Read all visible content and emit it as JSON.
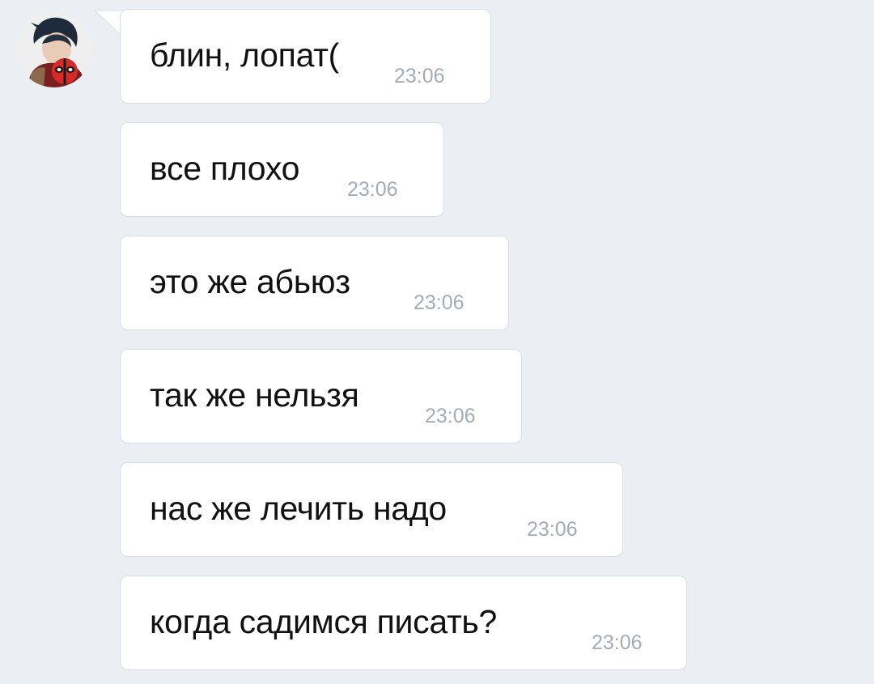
{
  "chat": {
    "messages": [
      {
        "text": "блин, лопат(",
        "time": "23:06"
      },
      {
        "text": "все плохо",
        "time": "23:06"
      },
      {
        "text": "это же абьюз",
        "time": "23:06"
      },
      {
        "text": "так же нельзя",
        "time": "23:06"
      },
      {
        "text": "нас же лечить надо",
        "time": "23:06"
      },
      {
        "text": "когда садимся писать?",
        "time": "23:06"
      }
    ]
  },
  "colors": {
    "background": "#ebeff4",
    "bubble": "#ffffff",
    "bubble_border": "#d8dee6",
    "text": "#111111",
    "timestamp": "#a3abb6"
  },
  "icons": {
    "avatar": "user-avatar-icon"
  }
}
